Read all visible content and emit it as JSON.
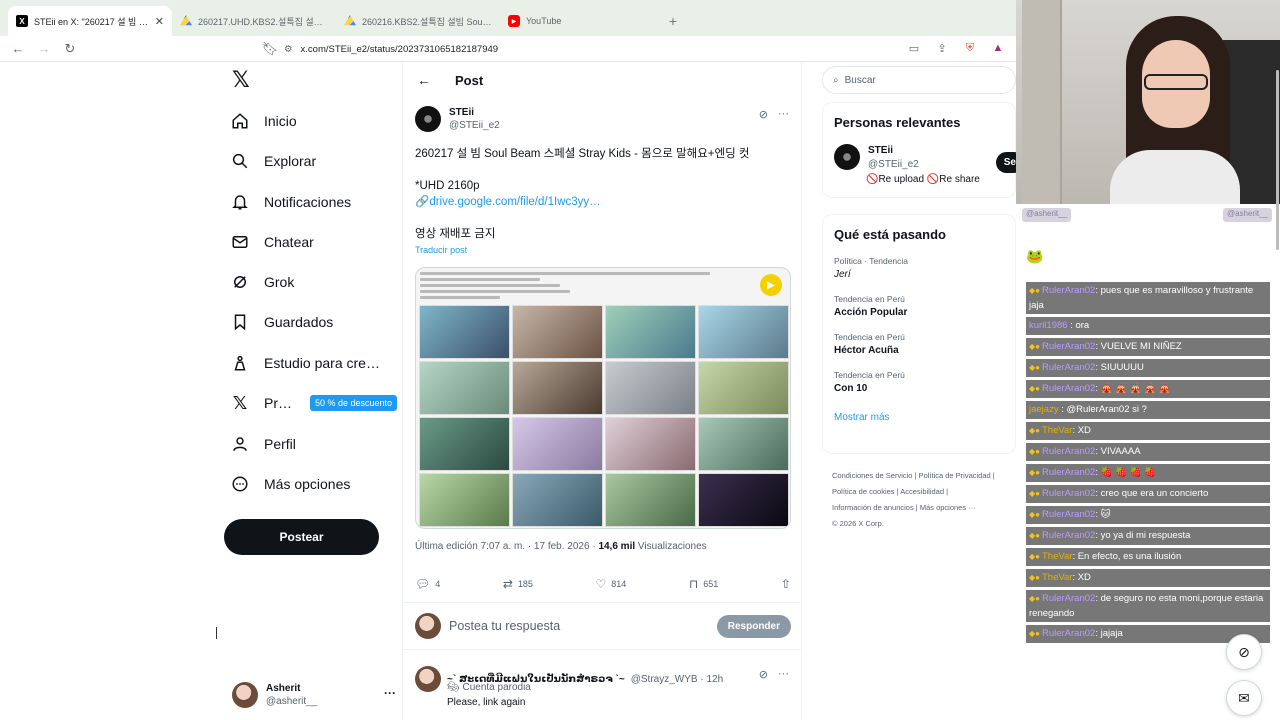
{
  "browser": {
    "tabs": [
      {
        "label": "STEii en X: \"260217 설 빔 Soul Be…",
        "favicon": "x-icon",
        "active": true
      },
      {
        "label": "260217.UHD.KBS2.설특집 설빔 Soul …",
        "favicon": "drive-icon",
        "active": false
      },
      {
        "label": "260216.KBS2.설특집 설빔 Soul Beam…",
        "favicon": "drive-icon",
        "active": false
      },
      {
        "label": "YouTube",
        "favicon": "youtube-icon",
        "active": false
      }
    ],
    "url": "x.com/STEii_e2/status/2023731065182187949"
  },
  "sidebar": {
    "items": [
      {
        "label": "Inicio",
        "icon": "home-icon"
      },
      {
        "label": "Explorar",
        "icon": "search-icon"
      },
      {
        "label": "Notificaciones",
        "icon": "bell-icon"
      },
      {
        "label": "Chatear",
        "icon": "mail-icon"
      },
      {
        "label": "Grok",
        "icon": "grok-icon"
      },
      {
        "label": "Guardados",
        "icon": "bookmark-icon"
      },
      {
        "label": "Estudio para cre…",
        "icon": "creator-icon"
      },
      {
        "label": "Pr…",
        "icon": "x-premium-icon",
        "badge": "50 % de descuento"
      },
      {
        "label": "Perfil",
        "icon": "person-icon"
      },
      {
        "label": "Más opciones",
        "icon": "more-circle-icon"
      }
    ],
    "post_button": "Postear",
    "account": {
      "name": "Asherit",
      "handle": "@asherit__"
    }
  },
  "main": {
    "header_title": "Post",
    "author": {
      "name": "STEii",
      "handle": "@STEii_e2"
    },
    "text": {
      "line1": "260217 설 빔 Soul Beam 스페셜 Stray Kids - 몸으로 말해요+엔딩 컷",
      "line2": "*UHD 2160p",
      "link": "drive.google.com/file/d/1Iwc3yy…",
      "line3": "영상 재배포 금지"
    },
    "translate": "Traducir post",
    "meta": {
      "edited": "Última edición 7:07 a. m. · 17 feb. 2026 · ",
      "views": "14,6 mil",
      "views_label": " Visualizaciones"
    },
    "actions": {
      "replies": "4",
      "reposts": "185",
      "likes": "814",
      "bookmarks": "651"
    },
    "reply_placeholder": "Postea tu respuesta",
    "reply_button": "Responder",
    "reply": {
      "name": "~` ສະເດທີ່ມີແຟນໃນເປັນນັກສຳຣວຈ `~",
      "handle": "@Strayz_WYB · 12h",
      "sub": "Cuenta parodia",
      "text": "Please, link again"
    }
  },
  "right": {
    "search_placeholder": "Buscar",
    "relevant_title": "Personas relevantes",
    "person": {
      "name": "STEii",
      "handle": "@STEii_e2",
      "bio": "🚫Re upload 🚫Re share",
      "follow": "Se"
    },
    "trends_title": "Qué está pasando",
    "trends": [
      {
        "context": "Política · Tendencia",
        "name": "Jerí"
      },
      {
        "context": "Tendencia en Perú",
        "name": "Acción Popular"
      },
      {
        "context": "Tendencia en Perú",
        "name": "Héctor Acuña"
      },
      {
        "context": "Tendencia en Perú",
        "name": "Con 10"
      }
    ],
    "show_more": "Mostrar más",
    "footer": {
      "row1": "Condiciones de Servicio  |  Política de Privacidad  |",
      "row2": "Política de cookies  |  Accesibilidad  |",
      "row3": "Información de anuncios  |  Más opciones ···",
      "row4": "© 2026 X Corp."
    }
  },
  "chat": {
    "header_left": "@asherit__",
    "header_right": "@asherit__",
    "messages": [
      {
        "user": "RulerAran02",
        "text": ": pues que es maravilloso y frustrante jaja"
      },
      {
        "user": "kuril1986",
        "text": ": ora"
      },
      {
        "user": "RulerAran02",
        "text": ": VUELVE MI NIÑEZ"
      },
      {
        "user": "RulerAran02",
        "text": ": SIUUUUU"
      },
      {
        "user": "RulerAran02",
        "text": ": 🎪 🎪 🎪 🎪 🎪"
      },
      {
        "user": "jaejazy",
        "text": ": @RulerAran02 si ?"
      },
      {
        "user": "TheVar",
        "text": ": XD"
      },
      {
        "user": "RulerAran02",
        "text": ": VIVAAAA"
      },
      {
        "user": "RulerAran02",
        "text": ": 🍓 🍓 🍓 🍓"
      },
      {
        "user": "RulerAran02",
        "text": ": creo que era un concierto"
      },
      {
        "user": "RulerAran02",
        "text": ": 🐱"
      },
      {
        "user": "RulerAran02",
        "text": ": yo ya di mi respuesta"
      },
      {
        "user": "TheVar",
        "text": ": En efecto, es una ilusión"
      },
      {
        "user": "TheVar",
        "text": ": XD"
      },
      {
        "user": "RulerAran02",
        "text": ": de seguro no esta moni,porque estaria renegando"
      },
      {
        "user": "RulerAran02",
        "text": ": jajaja"
      }
    ]
  },
  "colors": {
    "accent": "#1d9bf0",
    "text": "#0f1419",
    "muted": "#536471",
    "chat_bg": "#777777"
  }
}
